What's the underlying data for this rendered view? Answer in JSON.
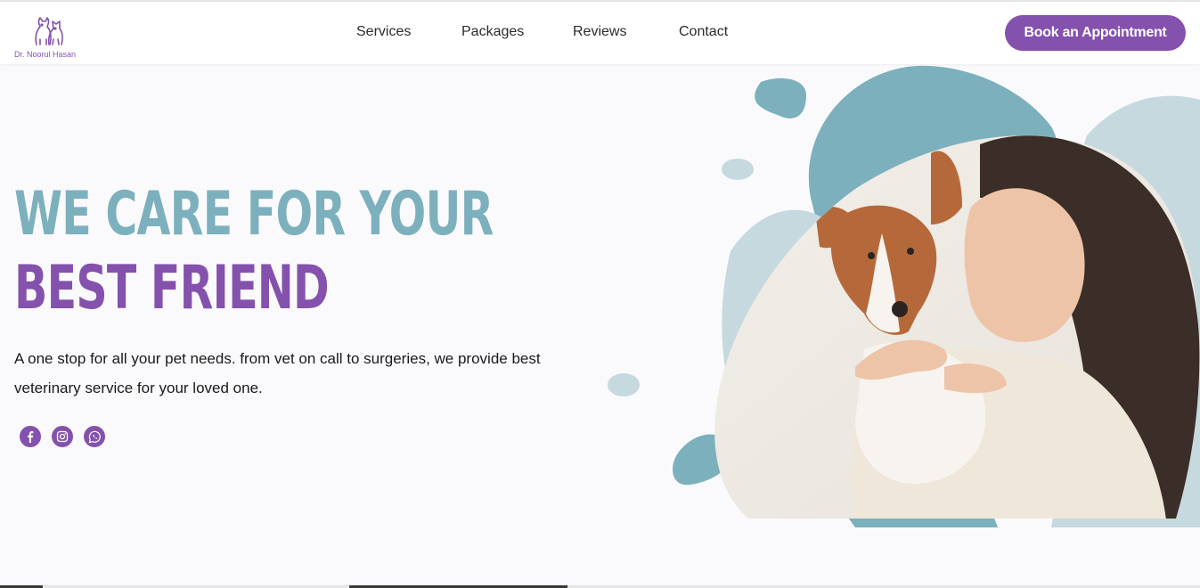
{
  "brand": {
    "name": "Dr. Noorul Hasan",
    "icon": "dog-and-cat-icon",
    "color": "#8451ad"
  },
  "nav": {
    "items": [
      {
        "label": "Services"
      },
      {
        "label": "Packages"
      },
      {
        "label": "Reviews"
      },
      {
        "label": "Contact"
      }
    ]
  },
  "cta": {
    "label": "Book an Appointment"
  },
  "hero": {
    "title_line1": "WE CARE FOR YOUR",
    "title_line2": "BEST FRIEND",
    "description": "A one stop for all your pet needs. from vet on call to surgeries, we provide best veterinary service for your loved one."
  },
  "social": [
    {
      "icon": "facebook-icon"
    },
    {
      "icon": "instagram-icon"
    },
    {
      "icon": "whatsapp-icon"
    }
  ],
  "colors": {
    "accent": "#8451ad",
    "teal": "#7db0bd",
    "light_teal": "#c5d9df"
  }
}
